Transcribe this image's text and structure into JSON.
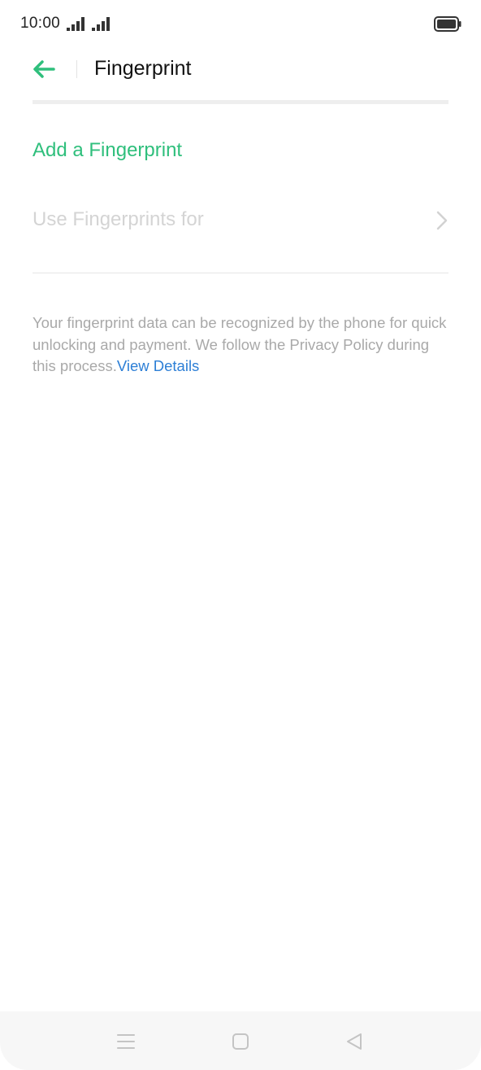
{
  "status_bar": {
    "time": "10:00",
    "icons": [
      "signal-icon",
      "signal-icon",
      "battery-icon"
    ]
  },
  "header": {
    "back_icon": "arrow-left-icon",
    "title": "Fingerprint"
  },
  "main": {
    "add_fingerprint_label": "Add a Fingerprint",
    "use_fingerprints_label": "Use Fingerprints for",
    "use_fingerprints_icon": "chevron-right-icon",
    "info_text": "Your fingerprint data can be recognized by the phone for quick unlocking and payment. We follow the Privacy Policy during this process.",
    "view_details_link": "View Details"
  },
  "nav_bar": {
    "icons": [
      "menu-icon",
      "home-icon",
      "back-triangle-icon"
    ]
  },
  "colors": {
    "accent_green": "#2fbf7c",
    "link_blue": "#2d7fd6",
    "disabled_text": "#d4d4d4",
    "info_text": "#a9a9a9"
  }
}
